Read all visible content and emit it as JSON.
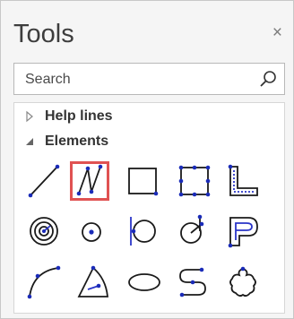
{
  "panel": {
    "title": "Tools",
    "close_label": "×"
  },
  "search": {
    "placeholder": "Search",
    "value": ""
  },
  "tree": {
    "nodes": [
      {
        "label": "Help lines",
        "expanded": false
      },
      {
        "label": "Elements",
        "expanded": true
      }
    ]
  },
  "tools": {
    "rows": [
      [
        "line-tool-icon",
        "polyline-tool-icon",
        "rectangle-tool-icon",
        "rectangle-points-tool-icon",
        "corner-profile-tool-icon"
      ],
      [
        "concentric-circles-tool-icon",
        "circle-center-tool-icon",
        "circle-tangent-tool-icon",
        "circle-offset-tool-icon",
        "p-shape-tool-icon"
      ],
      [
        "arc-tool-icon",
        "arc-sector-tool-icon",
        "ellipse-tool-icon",
        "s-curve-tool-icon",
        "cloud-shape-tool-icon"
      ]
    ],
    "selected": "polyline-tool-icon"
  }
}
